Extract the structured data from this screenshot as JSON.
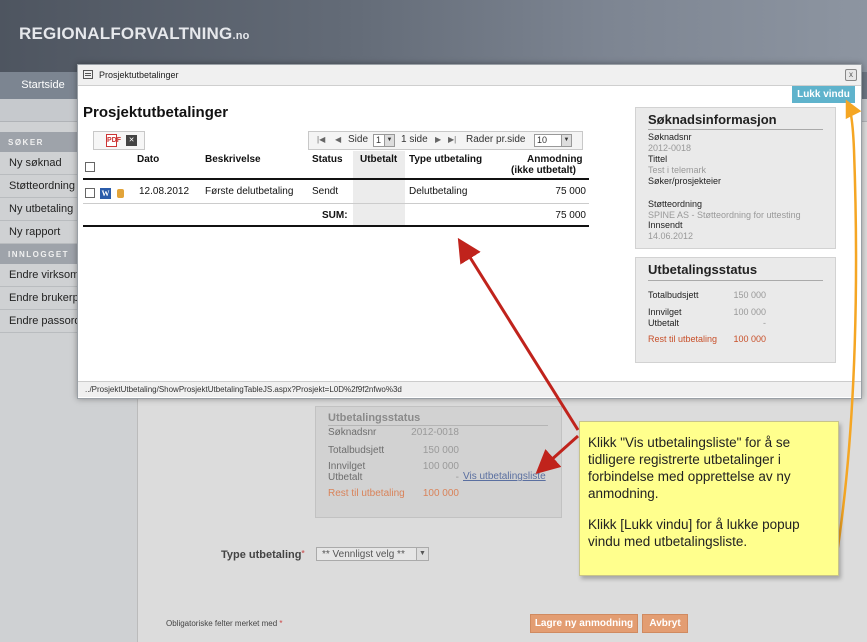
{
  "header": {
    "brand": "REGIONALFORVALTNING",
    "brand_suffix": ".no"
  },
  "nav": {
    "startside": "Startside"
  },
  "sidebar": {
    "section_soker": "SØKER",
    "items_soker": [
      "Ny søknad",
      "Støtteordning",
      "Ny utbetaling",
      "Ny rapport"
    ],
    "section_innlogget": "INNLOGGET",
    "items_innlogget": [
      "Endre virksomhet",
      "Endre brukerprofil",
      "Endre passord"
    ]
  },
  "page": {
    "status_box": {
      "title": "Utbetalingsstatus",
      "soknadsnr_label": "Søknadsnr",
      "soknadsnr": "2012-0018",
      "totalbudsjett_label": "Totalbudsjett",
      "totalbudsjett": "150 000",
      "innvilget_label": "Innvilget",
      "innvilget": "100 000",
      "utbetalt_label": "Utbetalt",
      "utbetalt": "-",
      "rest_label": "Rest til utbetaling",
      "rest": "100 000",
      "vis_link": "Vis utbetalingsliste"
    },
    "type_label": "Type utbetaling",
    "type_select": "** Vennligst velg **",
    "oblig_text": "Obligatoriske felter merket med",
    "lagre_button": "Lagre ny anmodning",
    "avbryt_button": "Avbryt"
  },
  "modal": {
    "window_title": "Prosjektutbetalinger",
    "close_glyph": "x",
    "lukk_button": "Lukk vindu",
    "heading": "Prosjektutbetalinger",
    "pager": {
      "side_label": "Side",
      "page": "1",
      "of_text": "1 side",
      "rows_label": "Rader pr.side",
      "rows": "10"
    },
    "columns": [
      "Dato",
      "Beskrivelse",
      "Status",
      "Utbetalt",
      "Type utbetaling",
      "Anmodning",
      "(ikke utbetalt)"
    ],
    "rows": [
      {
        "dato": "12.08.2012",
        "beskrivelse": "Første delutbetaling",
        "status": "Sendt",
        "utbetalt": "",
        "type": "Delutbetaling",
        "anmodning": "75 000"
      }
    ],
    "sum_label": "SUM:",
    "sum_value": "75 000",
    "info": {
      "title": "Søknadsinformasjon",
      "soknadsnr_label": "Søknadsnr",
      "soknadsnr": "2012-0018",
      "tittel_label": "Tittel",
      "tittel": "Test i telemark",
      "soker_label": "Søker/prosjekteier",
      "stotte_label": "Støtteordning",
      "stotte": "SPINE AS - Støtteordning for uttesting",
      "innsendt_label": "Innsendt",
      "innsendt": "14.06.2012"
    },
    "payment": {
      "title": "Utbetalingsstatus",
      "totalbudsjett_label": "Totalbudsjett",
      "totalbudsjett": "150 000",
      "innvilget_label": "Innvilget",
      "innvilget": "100 000",
      "utbetalt_label": "Utbetalt",
      "utbetalt": "-",
      "rest_label": "Rest til utbetaling",
      "rest": "100 000"
    },
    "status_url": "../ProsjektUtbetaling/ShowProsjektUtbetalingTableJS.aspx?Prosjekt=L0D%2f9f2nfwo%3d"
  },
  "callout": {
    "para1": "Klikk \"Vis utbetalingsliste\" for å se tidligere registrerte utbetalinger i forbindelse med opprettelse av ny anmodning.",
    "para2": "Klikk [Lukk vindu] for å lukke popup vindu med utbetalingsliste."
  },
  "colors": {
    "accent": "#5fb3cc",
    "orange_button": "#e39d72",
    "callout_bg": "#ffff8d",
    "arrow_red": "#c0231c",
    "arrow_orange": "#f5a623"
  }
}
